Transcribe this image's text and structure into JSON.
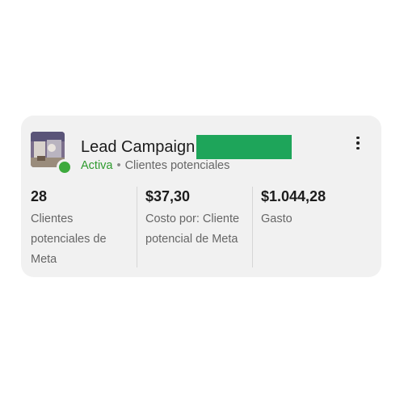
{
  "campaign": {
    "title": "Lead Campaign",
    "status": "Activa",
    "separator": "•",
    "objective": "Clientes potenciales",
    "status_color": "#3daa3d",
    "redaction_color": "#1ea55a"
  },
  "metrics": [
    {
      "value": "28",
      "label": "Clientes potenciales de Meta"
    },
    {
      "value": "$37,30",
      "label": "Costo por: Cliente potencial de Meta"
    },
    {
      "value": "$1.044,28",
      "label": "Gasto"
    }
  ],
  "menu": {
    "icon": "more-vertical-icon"
  }
}
